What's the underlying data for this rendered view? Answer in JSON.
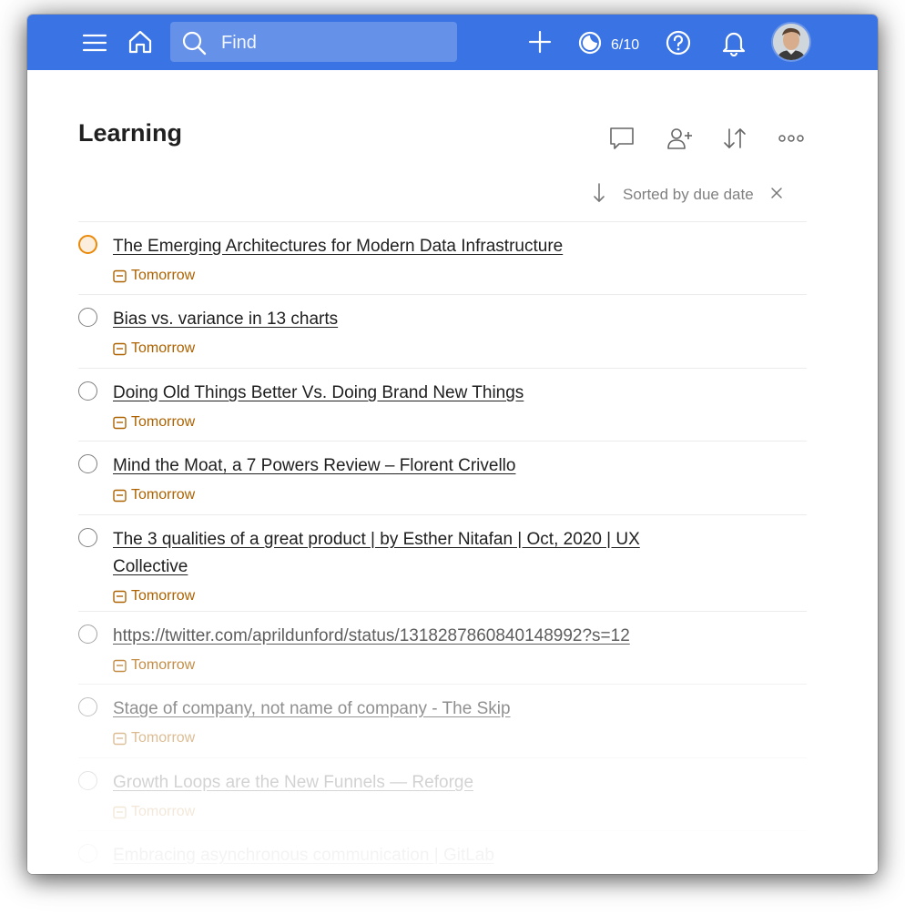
{
  "topbar": {
    "search_placeholder": "Find",
    "karma_label": "6/10"
  },
  "project": {
    "title": "Learning"
  },
  "sort": {
    "label": "Sorted by due date"
  },
  "tasks": [
    {
      "title": "The Emerging Architectures for Modern Data Infrastructure",
      "due": "Tomorrow",
      "priority": "p1"
    },
    {
      "title": "Bias vs. variance in 13 charts",
      "due": "Tomorrow",
      "priority": "p4"
    },
    {
      "title": "Doing Old Things Better Vs. Doing Brand New Things",
      "due": "Tomorrow",
      "priority": "p4"
    },
    {
      "title": "Mind the Moat, a 7 Powers Review – Florent Crivello",
      "due": "Tomorrow",
      "priority": "p4"
    },
    {
      "title": "The 3 qualities of a great product | by Esther Nitafan | Oct, 2020 | UX Collective",
      "due": "Tomorrow",
      "priority": "p4"
    },
    {
      "title": "https://twitter.com/aprildunford/status/1318287860840148992?s=12",
      "due": "Tomorrow",
      "priority": "p4"
    },
    {
      "title": "Stage of company, not name of company - The Skip",
      "due": "Tomorrow",
      "priority": "p4"
    },
    {
      "title": "Growth Loops are the New Funnels — Reforge",
      "due": "Tomorrow",
      "priority": "p4"
    },
    {
      "title": "Embracing asynchronous communication | GitLab",
      "due": "",
      "priority": "p4"
    }
  ],
  "colors": {
    "topbar": "#3a73e3",
    "due_text": "#ad6200",
    "priority_1": "#eb8909"
  }
}
